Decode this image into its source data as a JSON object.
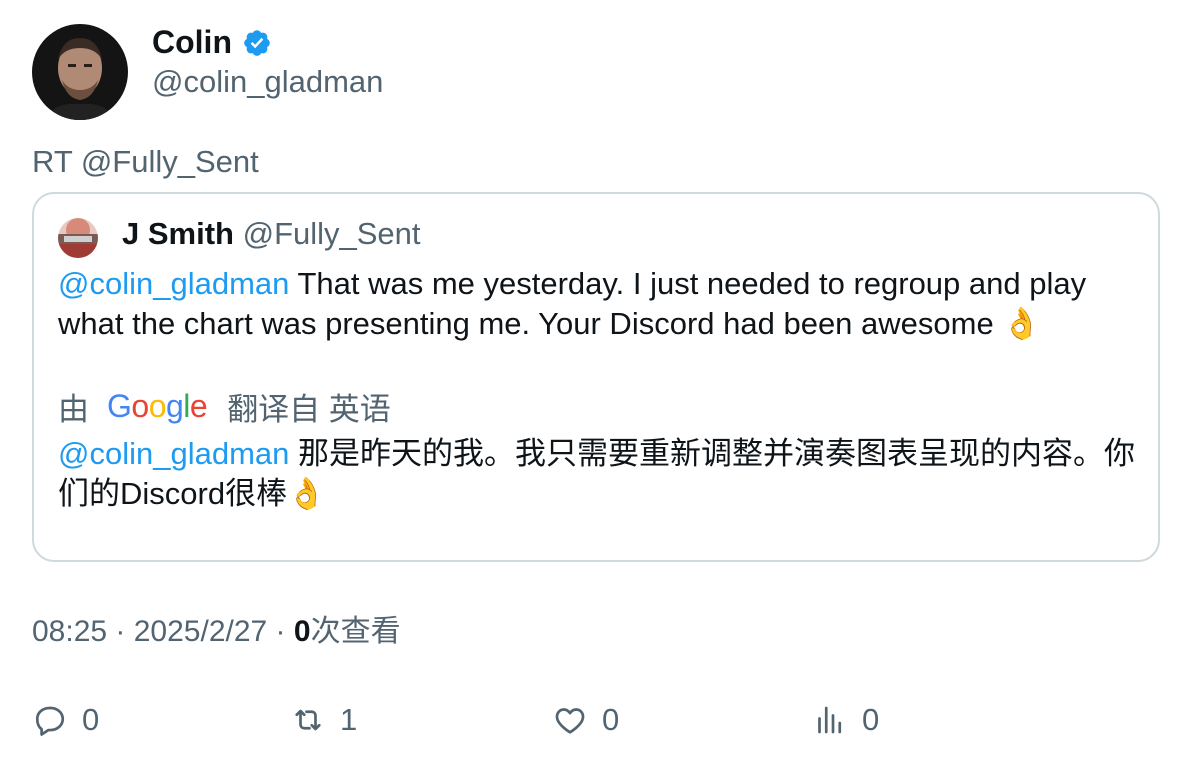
{
  "author": {
    "name": "Colin",
    "handle": "@colin_gladman",
    "verified_color": "#1d9bf0"
  },
  "retweet_text": "RT @Fully_Sent",
  "quoted": {
    "name": "J Smith",
    "handle": "@Fully_Sent",
    "mention": "@colin_gladman",
    "text": "That was me yesterday. I just needed to regroup and play what the chart was presenting me. Your Discord had been awesome 👌",
    "translate": {
      "prefix": "由",
      "provider": "Google",
      "suffix": "翻译自 英语"
    },
    "translated_mention": "@colin_gladman",
    "translated_text": "那是昨天的我。我只需要重新调整并演奏图表呈现的内容。你们的Discord很棒👌"
  },
  "meta": {
    "time": "08:25",
    "separator": " · ",
    "date": "2025/2/27",
    "views_count": "0",
    "views_label": "次查看"
  },
  "actions": {
    "reply_count": "0",
    "retweet_count": "1",
    "like_count": "0",
    "views_count": "0"
  },
  "colors": {
    "link": "#1d9bf0",
    "secondary_text": "#536471",
    "border": "#cfd9de"
  }
}
